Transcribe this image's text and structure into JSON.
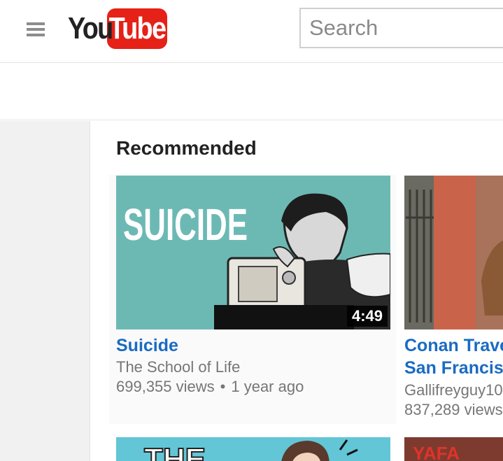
{
  "header": {
    "logo_you": "You",
    "logo_tube": "Tube",
    "search_placeholder": "Search"
  },
  "main": {
    "section_title": "Recommended",
    "videos": [
      {
        "title": "Suicide",
        "channel": "The School of Life",
        "views": "699,355 views",
        "age": "1 year ago",
        "duration": "4:49",
        "thumb_text": "SUICIDE"
      },
      {
        "title_line1": "Conan Trave",
        "title_line2": "San Francisc",
        "channel": "Gallifreyguy10",
        "views": "837,289 views"
      }
    ],
    "row2": [
      {
        "thumb_text": "THE"
      },
      {
        "thumb_text": "YAFA"
      }
    ]
  },
  "colors": {
    "brand_red": "#e62117",
    "link_blue": "#1a6bc2",
    "meta_gray": "#767676"
  }
}
